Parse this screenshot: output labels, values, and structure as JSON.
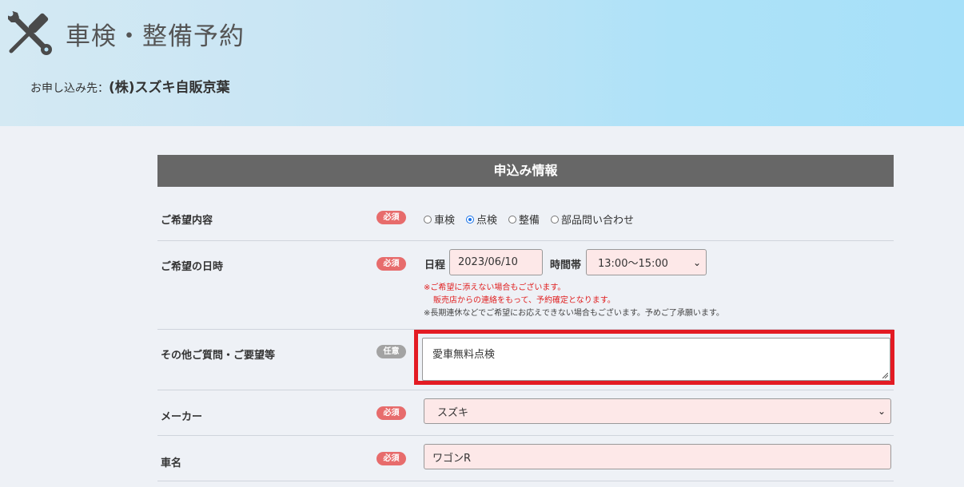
{
  "header": {
    "title": "車検・整備予約",
    "destination_label": "お申し込み先：",
    "destination_shop": "(株)スズキ自販京葉"
  },
  "form": {
    "section_title": "申込み情報",
    "badges": {
      "required": "必須",
      "optional": "任意"
    },
    "desired_content": {
      "label": "ご希望内容",
      "options": [
        "車検",
        "点検",
        "整備",
        "部品問い合わせ"
      ],
      "selected": "点検"
    },
    "desired_datetime": {
      "label": "ご希望の日時",
      "date_label": "日程",
      "date_value": "2023/06/10",
      "time_label": "時間帯",
      "time_value": "13:00〜15:00",
      "note_red_1": "※ご希望に添えない場合もございます。",
      "note_red_2": "販売店からの連絡をもって、予約確定となります。",
      "note_gray": "※長期連休などでご希望にお応えできない場合もございます。予めご了承願います。"
    },
    "other_requests": {
      "label": "その他ご質問・ご要望等",
      "value": "愛車無料点検"
    },
    "maker": {
      "label": "メーカー",
      "value": "スズキ"
    },
    "car_name": {
      "label": "車名",
      "value": "ワゴンR"
    }
  },
  "colors": {
    "header_gradient_start": "#d4e9f3",
    "header_gradient_end": "#a6e0f9",
    "section_bar": "#676767",
    "required_badge": "#e76c6c",
    "optional_badge": "#a3a3a3",
    "field_background": "#fde8e8",
    "highlight_border": "#e31b23",
    "radio_selected": "#1a73e8"
  },
  "icons": {
    "header": "wrench-screwdriver-icon",
    "select": "chevron-down-icon"
  }
}
